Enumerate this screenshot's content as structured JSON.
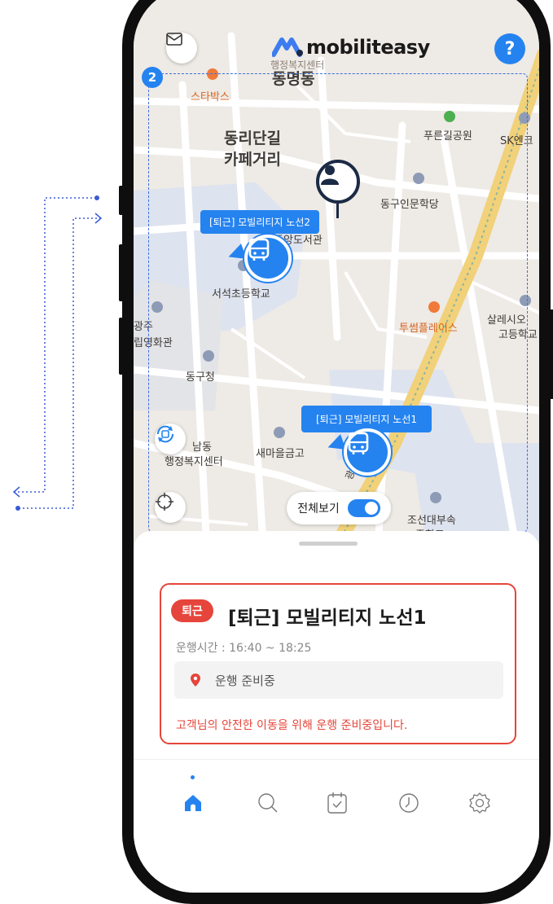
{
  "header": {
    "brand": "mobiliteasy",
    "help_label": "?",
    "frame_badge": "2"
  },
  "map": {
    "labels": {
      "starbucks": "스타박스",
      "district": "동명동",
      "admin_center": "행정복지센터",
      "cafe_street_1": "동리단길",
      "cafe_street_2": "카페거리",
      "park": "푸른길공원",
      "sk": "SK엔크",
      "library": "중앙도서관",
      "school": "서석초등학교",
      "academy": "동구인문학당",
      "gwangju": "광주",
      "film": "립영화관",
      "gu_office": "동구청",
      "twosome": "투썸플레이스",
      "salesio_1": "살레시오",
      "salesio_2": "고등학교",
      "nam_dong": "남동",
      "welfare": "행정복지센터",
      "saemaul": "새마을금고",
      "chosun_1": "조선대부속",
      "chosun_2": "중학교",
      "road": "광주2"
    },
    "bus_tags": {
      "route2": "[퇴근] 모빌리티지 노선2",
      "route1": "[퇴근] 모빌리티지 노선1"
    },
    "view_all_label": "전체보기",
    "view_all_on": true
  },
  "card": {
    "badge": "퇴근",
    "title": "[퇴근] 모빌리티지 노선1",
    "time": "운행시간 : 16:40 ~ 18:25",
    "status": "운행 준비중",
    "notice": "고객님의 안전한 이동을 위해 운행 준비중입니다."
  },
  "nav": {
    "items": [
      "home-icon",
      "search-icon",
      "calendar-check-icon",
      "clock-icon",
      "settings-icon"
    ],
    "active": "home-icon"
  },
  "colors": {
    "accent": "#2583f0",
    "alert": "#e5453a",
    "frame": "#0e0e0e"
  }
}
